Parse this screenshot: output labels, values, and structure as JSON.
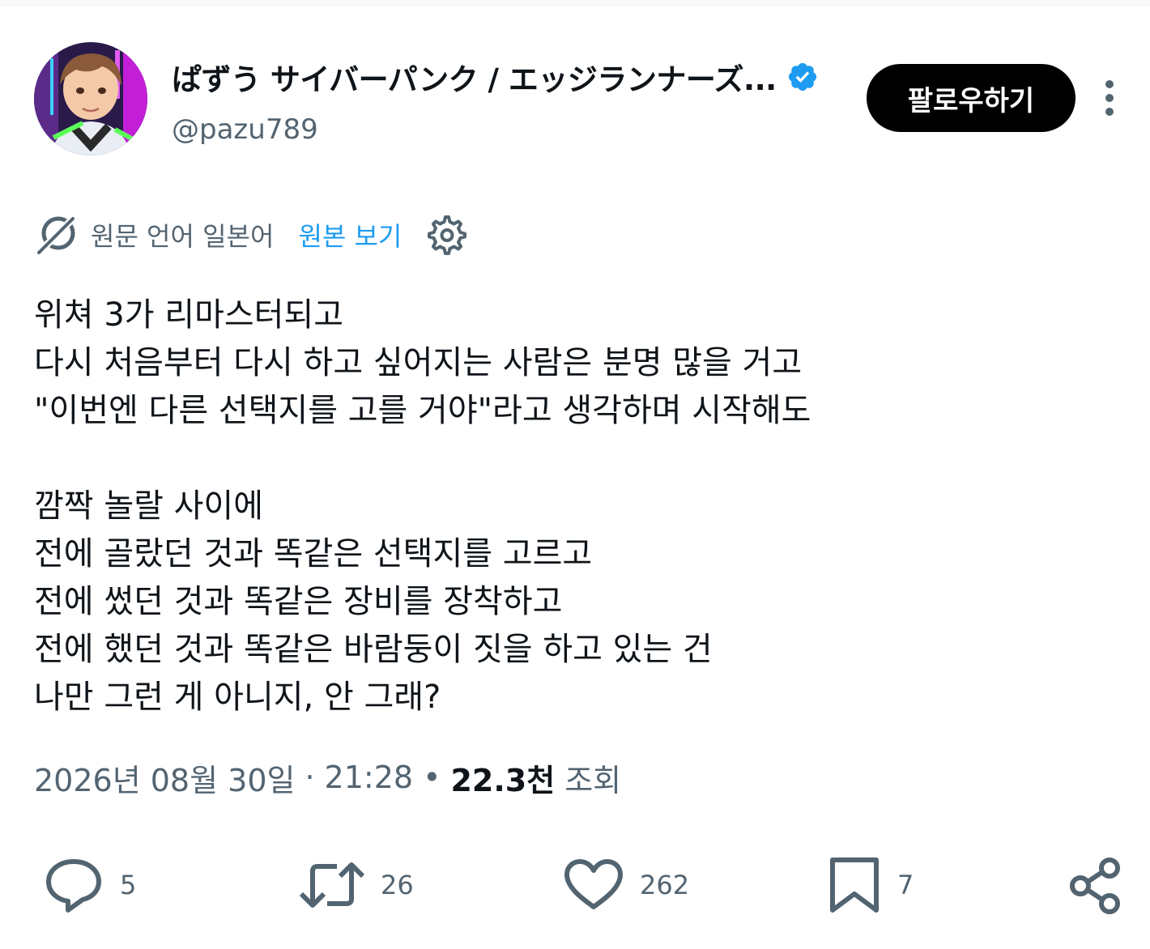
{
  "author": {
    "display_name": "ぱずう サイバーパンク / エッジランナーズ...",
    "handle": "@pazu789",
    "verified": true
  },
  "follow_label": "팔로우하기",
  "translation": {
    "label": "원문 언어 일본어",
    "show_original": "원본 보기"
  },
  "tweet_lines": [
    "위쳐 3가 리마스터되고",
    "다시 처음부터 다시 하고 싶어지는 사람은 분명 많을 거고",
    "\"이번엔 다른 선택지를 고를 거야\"라고 생각하며 시작해도",
    "",
    "깜짝 놀랄 사이에",
    "전에 골랐던 것과 똑같은 선택지를 고르고",
    "전에 썼던 것과 똑같은 장비를 장착하고",
    "전에 했던 것과 똑같은 바람둥이 짓을 하고 있는 건",
    "나만 그런 게 아니지, 안 그래?"
  ],
  "meta": {
    "date": "2026년 08월 30일",
    "time": "21:28",
    "separator_dot": "·",
    "separator_bullet": "•",
    "views_count": "22.3천",
    "views_label": "조회"
  },
  "actions": {
    "reply_count": "5",
    "retweet_count": "26",
    "like_count": "262",
    "bookmark_count": "7"
  },
  "colors": {
    "accent": "#1d9bf0",
    "secondary_text": "#536471",
    "primary_text": "#0f1419",
    "button_bg": "#000000"
  }
}
